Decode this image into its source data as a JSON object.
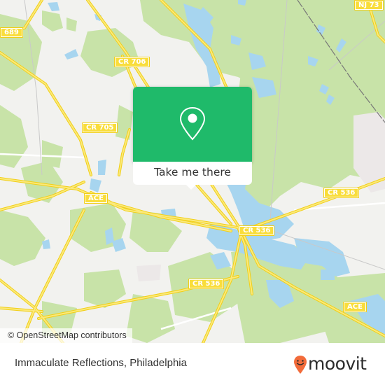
{
  "map": {
    "colors": {
      "land": "#f2f2ef",
      "forest": "#c8e3a8",
      "water": "#a7d5ef",
      "road": "#f9dd3b",
      "industrial": "#ece8e8",
      "rail": "#777777"
    },
    "road_labels": [
      {
        "id": "689",
        "label": "689"
      },
      {
        "id": "cr706",
        "label": "CR 706"
      },
      {
        "id": "nj73",
        "label": "NJ 73"
      },
      {
        "id": "cr705",
        "label": "CR 705"
      },
      {
        "id": "ace-west",
        "label": "ACE"
      },
      {
        "id": "cr536-east",
        "label": "CR 536"
      },
      {
        "id": "cr536-center",
        "label": "CR 536"
      },
      {
        "id": "cr536-south",
        "label": "CR 536"
      },
      {
        "id": "ace-east",
        "label": "ACE"
      }
    ],
    "attribution": "© OpenStreetMap contributors"
  },
  "popup": {
    "icon": "map-pin-icon",
    "button_label": "Take me there",
    "accent_color": "#1fba6a"
  },
  "footer": {
    "place_name": "Immaculate Reflections, Philadelphia",
    "brand": "moovit",
    "brand_color": "#f26b3a"
  }
}
